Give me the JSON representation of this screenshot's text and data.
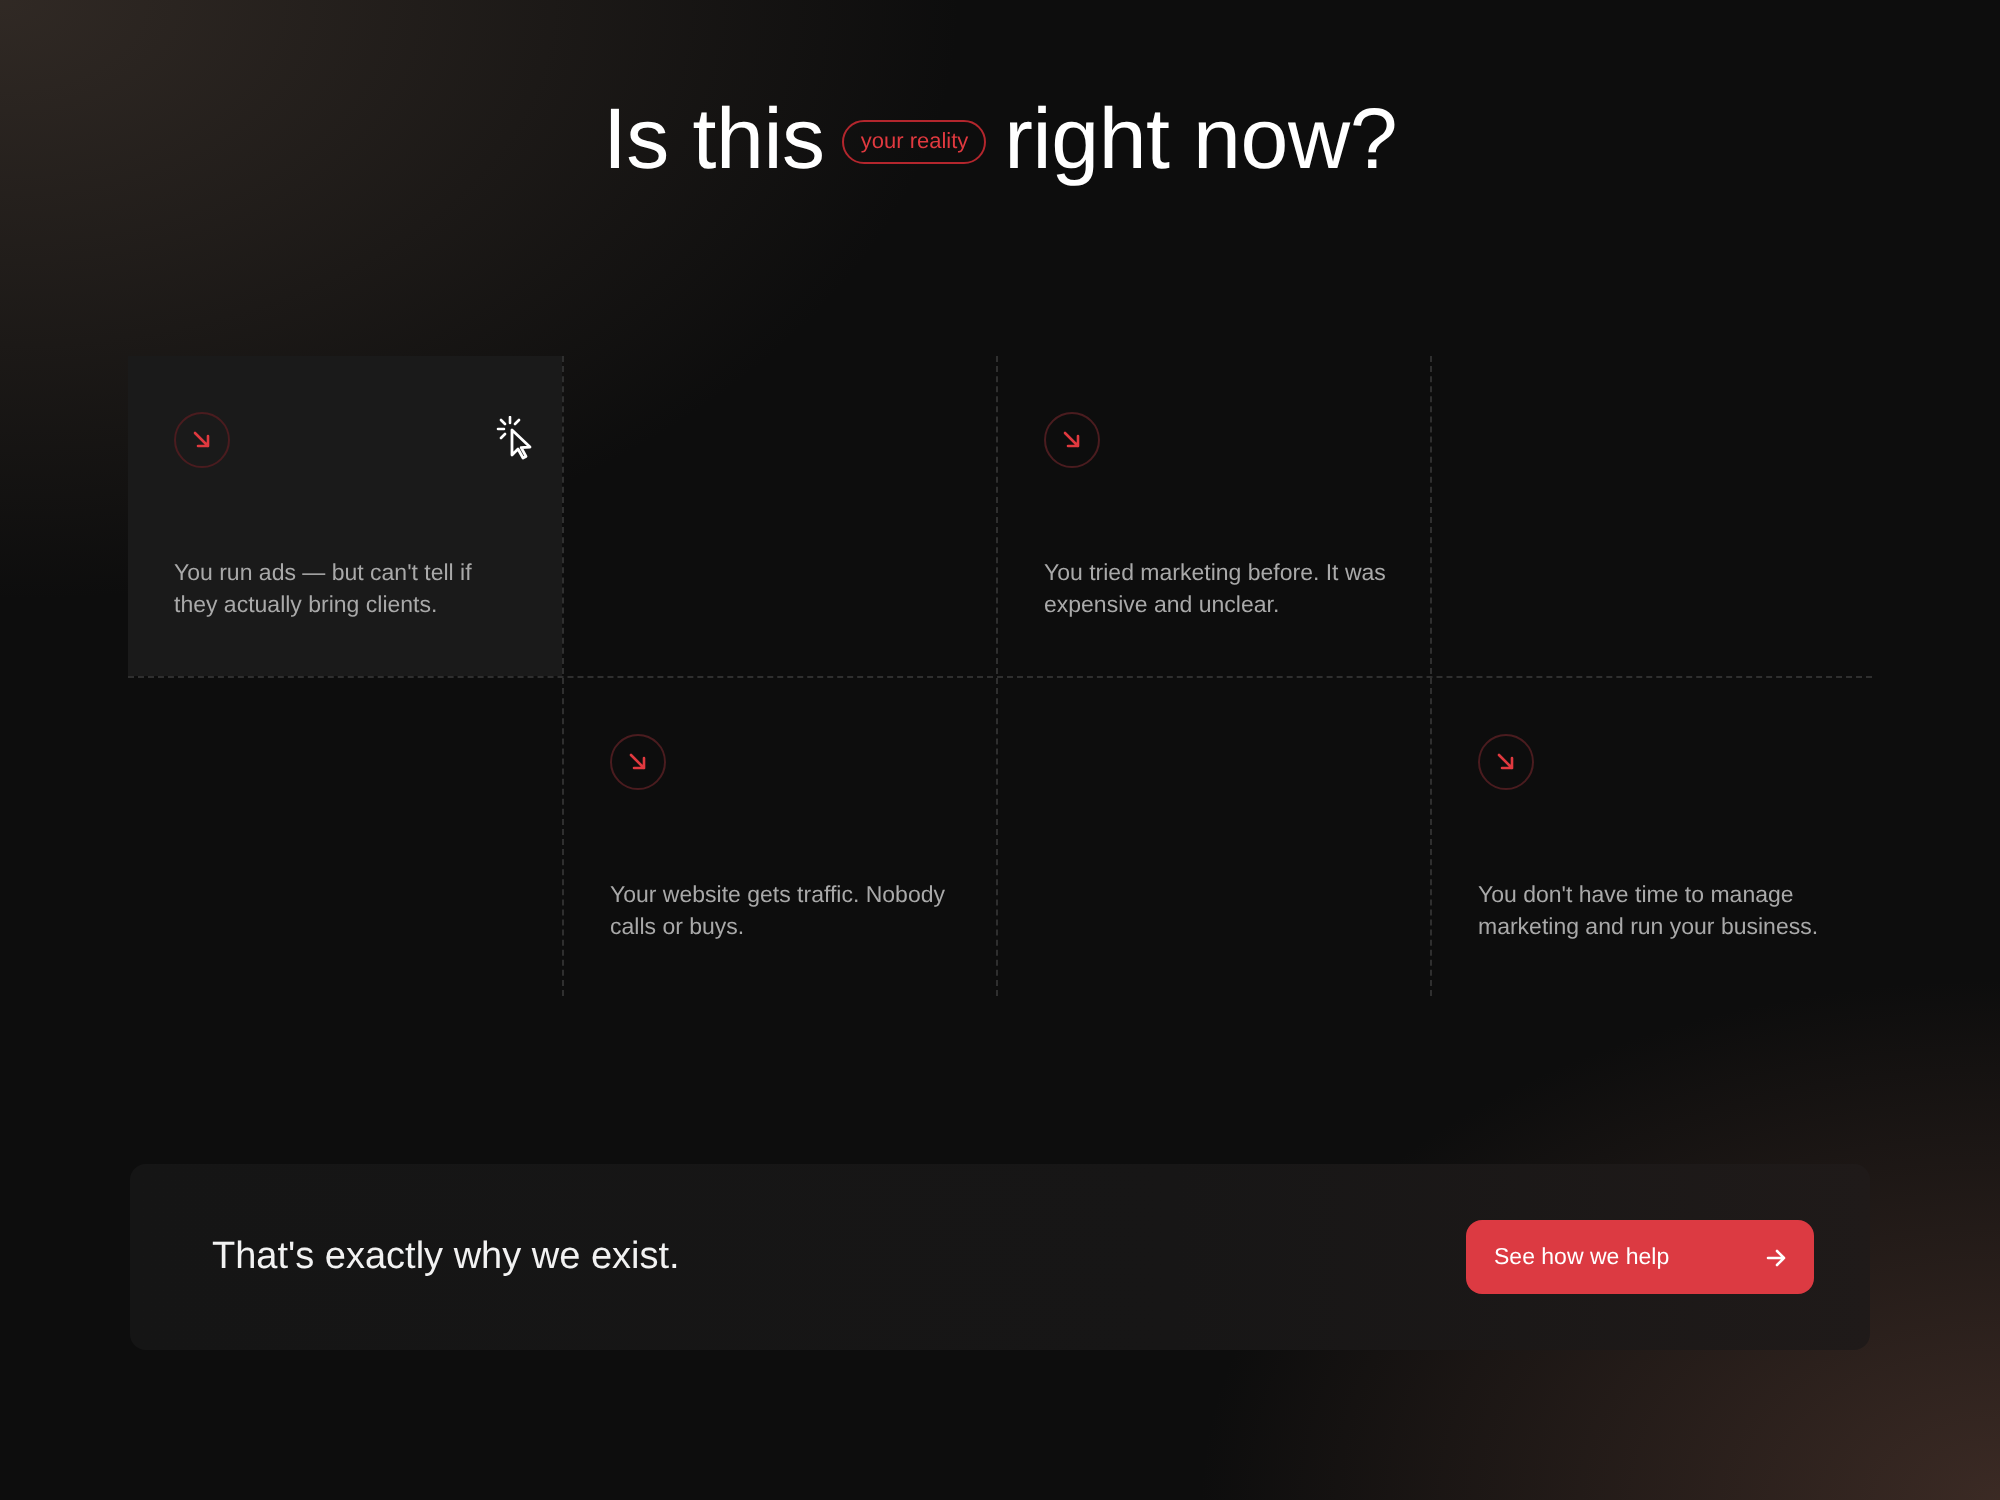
{
  "heading": {
    "before": "Is this",
    "tag": "your reality",
    "after": "right now?"
  },
  "grid": {
    "cells": [
      {
        "kind": "card",
        "text": "You run ads — but can't tell if they actually bring clients.",
        "hovered": true
      },
      {
        "kind": "empty"
      },
      {
        "kind": "card",
        "text": "You tried marketing before. It was expensive and unclear.",
        "hovered": false
      },
      {
        "kind": "empty"
      },
      {
        "kind": "empty"
      },
      {
        "kind": "card",
        "text": "Your website gets traffic. Nobody calls or buys.",
        "hovered": false
      },
      {
        "kind": "empty"
      },
      {
        "kind": "card",
        "text": "You don't have time to manage marketing and run your business.",
        "hovered": false
      }
    ]
  },
  "banner": {
    "text": "That's exactly why we exist.",
    "button": {
      "label": "See how we help"
    }
  }
}
